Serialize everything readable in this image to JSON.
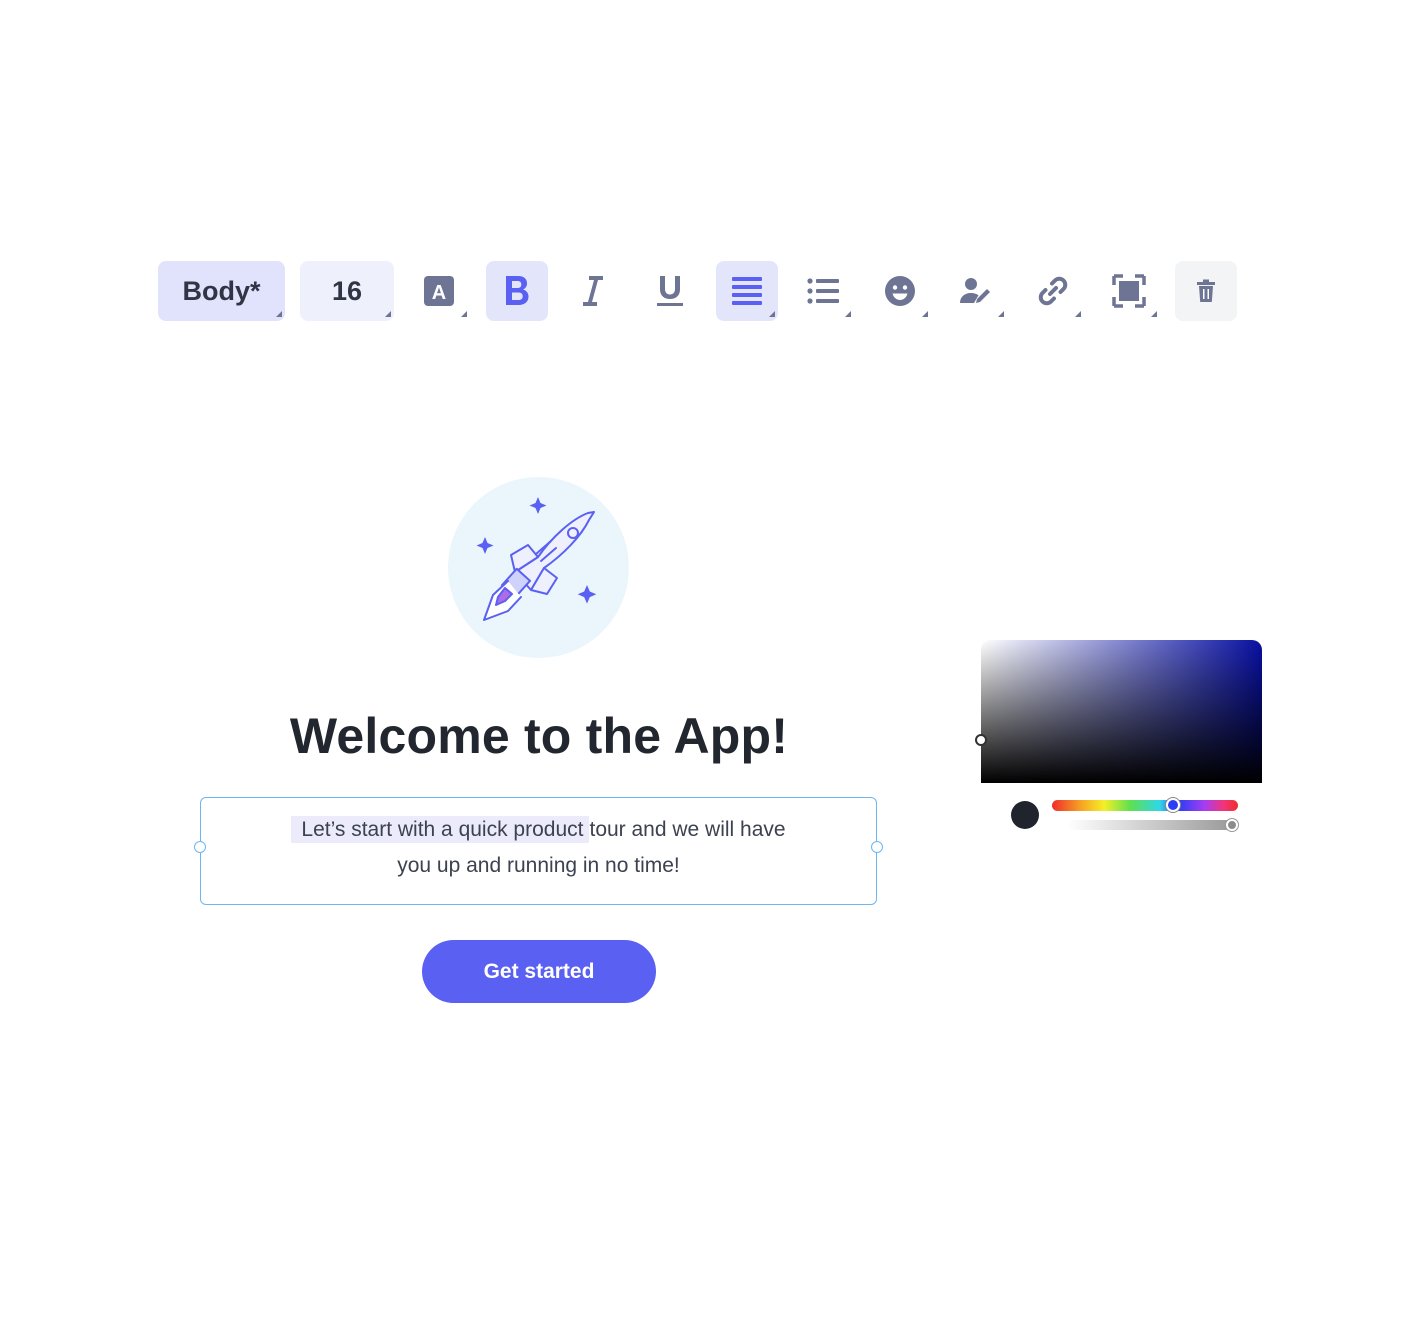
{
  "toolbar": {
    "text_style": "Body*",
    "font_size": "16",
    "font_color_icon_letter": "A",
    "icons": [
      "text-color-icon",
      "bold-icon",
      "italic-icon",
      "underline-icon",
      "align-center-icon",
      "list-icon",
      "emoji-icon",
      "user-edit-icon",
      "link-icon",
      "frame-icon",
      "trash-icon"
    ],
    "colors": {
      "active_bg": "#e1e2fb",
      "accent": "#5a60f2",
      "icon": "#6e7594"
    }
  },
  "hero": {
    "illustration": "rocket-icon"
  },
  "content": {
    "title": "Welcome to the App!",
    "body_selected": "Let’s start with a quick product",
    "body_rest": "tour and we will have",
    "body_line2": "you up and running in no time!",
    "cta_label": "Get started"
  },
  "color_picker": {
    "selected_color": "#20252d",
    "hue_color": "#0810a2"
  }
}
